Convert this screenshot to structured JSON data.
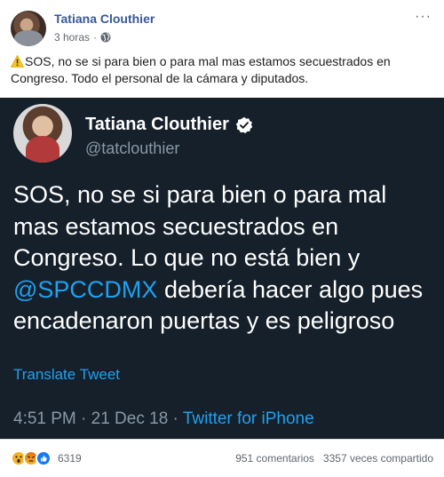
{
  "post": {
    "author": "Tatiana Clouthier",
    "time": "3 horas",
    "more": "···",
    "text": "SOS, no se si para bien o para mal mas estamos secuestrados en Congreso. Todo el personal de la cámara y diputados."
  },
  "tweet": {
    "name": "Tatiana Clouthier",
    "handle": "@tatclouthier",
    "body_before": "SOS, no se si para bien o para mal mas estamos secuestrados en Congreso. Lo que no está bien y",
    "mention": "@SPCCDMX",
    "body_after": "debería hacer algo pues encadenaron  puertas y es peligroso",
    "translate": "Translate Tweet",
    "timestamp": "4:51 PM · 21 Dec 18 · ",
    "source": "Twitter for iPhone"
  },
  "engagement": {
    "reaction_count": "6319",
    "comments": "951 comentarios",
    "shares": "3357 veces compartido"
  },
  "colors": {
    "link": "#385898",
    "tweet_bg": "#15202b",
    "twitter_blue": "#1da1f2"
  },
  "icons": [
    "warning-icon",
    "globe-icon",
    "more-icon",
    "verified-icon",
    "wow-reaction-icon",
    "angry-reaction-icon",
    "like-reaction-icon"
  ]
}
